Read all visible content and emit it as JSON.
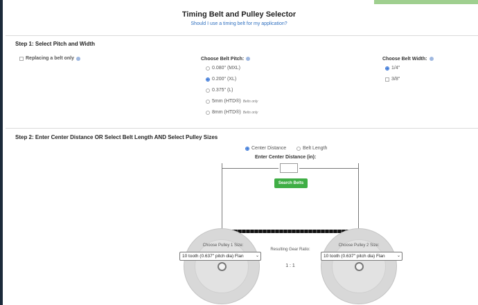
{
  "header": {
    "title": "Timing Belt and Pulley Selector",
    "subtitle": "Should I use a timing belt for my application?"
  },
  "step1": {
    "title": "Step 1: Select Pitch and Width",
    "replacing_label": "Replacing a belt only",
    "pitch_label": "Choose Belt Pitch:",
    "pitch_options": [
      {
        "label": "0.080\" (MXL)",
        "note": "",
        "selected": false
      },
      {
        "label": "0.200\" (XL)",
        "note": "",
        "selected": true
      },
      {
        "label": "0.375\" (L)",
        "note": "",
        "selected": false
      },
      {
        "label": "5mm (HTD®)",
        "note": "Belts only",
        "selected": false
      },
      {
        "label": "8mm (HTD®)",
        "note": "Belts only",
        "selected": false
      }
    ],
    "width_label": "Choose Belt Width:",
    "width_options": [
      {
        "label": "1/4\"",
        "selected": true
      },
      {
        "label": "3/8\"",
        "selected": false
      }
    ]
  },
  "step2": {
    "title": "Step 2: Enter Center Distance OR Select Belt Length AND Select Pulley Sizes",
    "mode_center": "Center Distance",
    "mode_length": "Belt Length",
    "center_label": "Enter Center Distance (in):",
    "center_value": "",
    "search_button": "Search Belts",
    "pulley1_label": "Choose Pulley 1 Size:",
    "pulley1_value": "10 tooth (0.637\" pitch dia) Flan",
    "pulley2_label": "Choose Pulley 2 Size:",
    "pulley2_value": "10 tooth (0.637\" pitch dia) Flan",
    "gear_ratio_label": "Resulting Gear Ratio:",
    "gear_ratio_value": "1 : 1"
  }
}
